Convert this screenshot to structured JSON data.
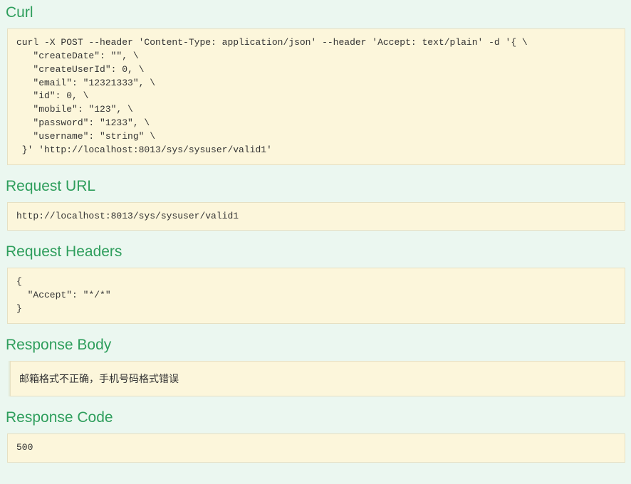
{
  "sections": {
    "curl": {
      "title": "Curl",
      "content": "curl -X POST --header 'Content-Type: application/json' --header 'Accept: text/plain' -d '{ \\\n   \"createDate\": \"\", \\\n   \"createUserId\": 0, \\\n   \"email\": \"12321333\", \\\n   \"id\": 0, \\\n   \"mobile\": \"123\", \\\n   \"password\": \"1233\", \\\n   \"username\": \"string\" \\\n }' 'http://localhost:8013/sys/sysuser/valid1'"
    },
    "request_url": {
      "title": "Request URL",
      "content": "http://localhost:8013/sys/sysuser/valid1"
    },
    "request_headers": {
      "title": "Request Headers",
      "content": "{\n  \"Accept\": \"*/*\"\n}"
    },
    "response_body": {
      "title": "Response Body",
      "content": "邮箱格式不正确，手机号码格式错误"
    },
    "response_code": {
      "title": "Response Code",
      "content": "500"
    }
  }
}
